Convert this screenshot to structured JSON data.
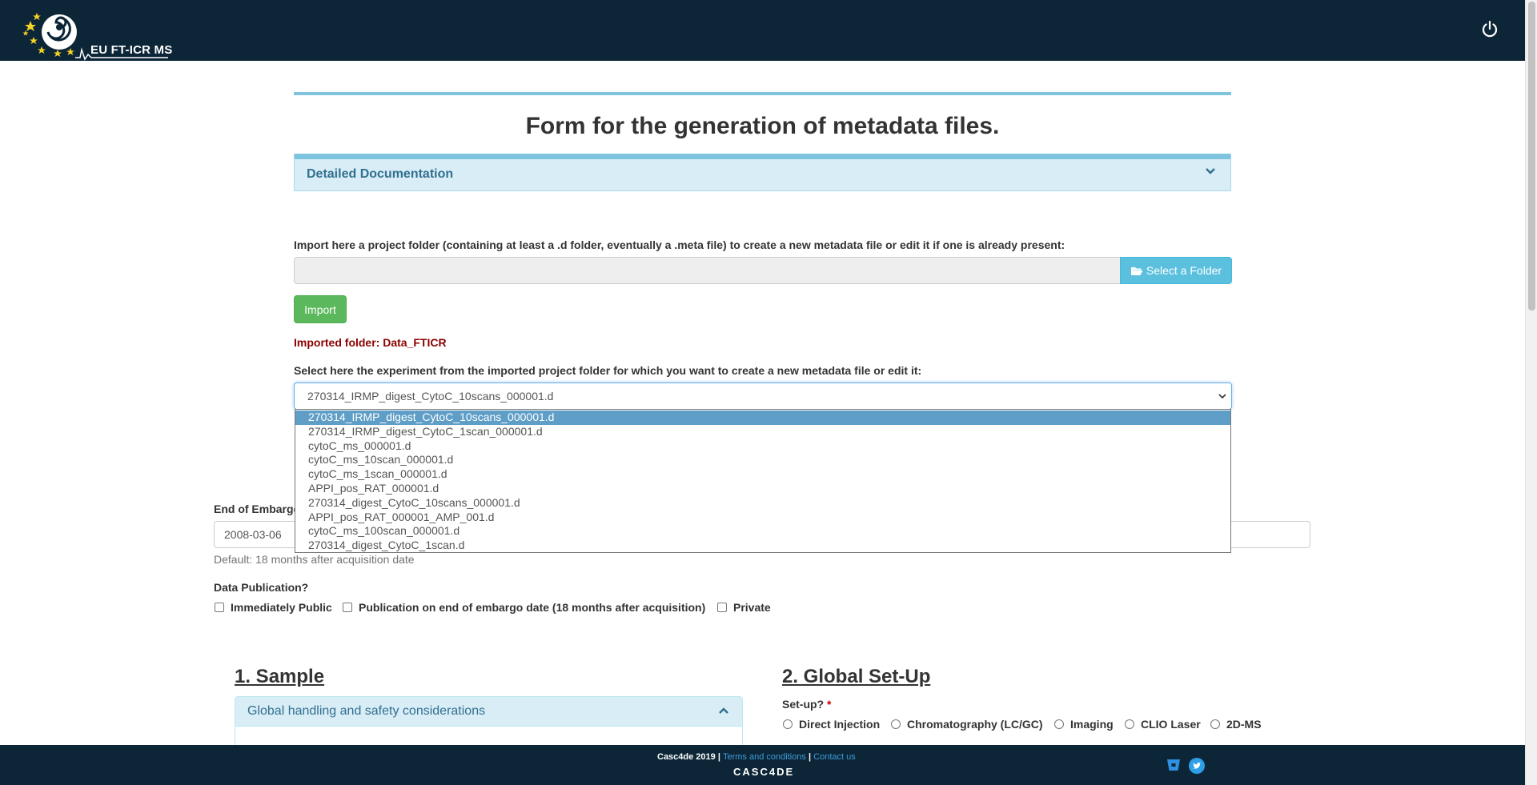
{
  "navbar": {
    "logo_text": "EU FT-ICR MS"
  },
  "page": {
    "title": "Form for the generation of metadata files.",
    "doc_panel_title": "Detailed Documentation"
  },
  "import": {
    "label": "Import here a project folder (containing at least a .d folder, eventually a .meta file) to create a new metadata file or edit it if one is already present:",
    "folder_value": "",
    "select_folder_label": "Select a Folder",
    "import_button_label": "Import",
    "imported_folder_text": "Imported folder: Data_FTICR"
  },
  "experiment": {
    "label": "Select here the experiment from the imported project folder for which you want to create a new metadata file or edit it:",
    "selected": "270314_IRMP_digest_CytoC_10scans_000001.d",
    "options": [
      "270314_IRMP_digest_CytoC_10scans_000001.d",
      "270314_IRMP_digest_CytoC_1scan_000001.d",
      "cytoC_ms_000001.d",
      "cytoC_ms_10scan_000001.d",
      "cytoC_ms_1scan_000001.d",
      "APPI_pos_RAT_000001.d",
      "270314_digest_CytoC_10scans_000001.d",
      "APPI_pos_RAT_000001_AMP_001.d",
      "cytoC_ms_100scan_000001.d",
      "270314_digest_CytoC_1scan.d"
    ]
  },
  "embargo": {
    "label": "End of Embargo",
    "value": "2008-03-06",
    "help": "Default: 18 months after acquisition date"
  },
  "publication": {
    "label": "Data Publication?",
    "options": [
      "Immediately Public",
      "Publication on end of embargo date (18 months after acquisition)",
      "Private"
    ]
  },
  "sample": {
    "title": "1. Sample",
    "panel_title": "Global handling and safety considerations"
  },
  "global_setup": {
    "title": "2. Global Set-Up",
    "label": "Set-up?",
    "required_mark": "*",
    "options": [
      "Direct Injection",
      "Chromatography (LC/GC)",
      "Imaging",
      "CLIO Laser",
      "2D-MS"
    ]
  },
  "footer": {
    "copyright": "Casc4de 2019 |",
    "terms_label": "Terms and conditions",
    "separator": "|",
    "contact_label": "Contact us",
    "brand": "CASC4DE"
  },
  "colors": {
    "navbar_bg": "#0c2638",
    "accent_blue": "#7ec4df",
    "select_folder_btn": "#5bc0de",
    "import_btn": "#5cb85c",
    "imported_text": "#8b0000",
    "selected_option": "#5f9ec7"
  }
}
